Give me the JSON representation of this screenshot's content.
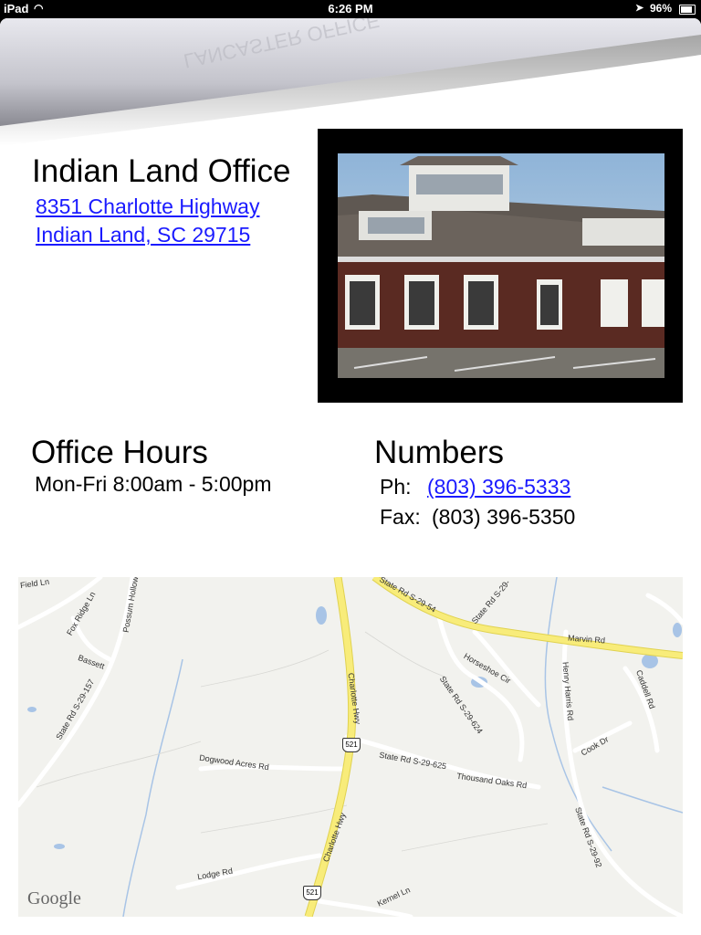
{
  "status_bar": {
    "device": "iPad",
    "time": "6:26 PM",
    "battery": "96%"
  },
  "page_curl": {
    "faded_text": "LANCASTER OFFICE"
  },
  "office": {
    "title": "Indian Land Office",
    "address_line1": "8351 Charlotte Highway",
    "address_line2": "Indian Land, SC 29715"
  },
  "hours": {
    "heading": "Office Hours",
    "text": "Mon-Fri 8:00am - 5:00pm"
  },
  "numbers": {
    "heading": "Numbers",
    "phone_label": "Ph:",
    "phone": "(803) 396-5333",
    "fax_label": "Fax:",
    "fax": "(803) 396-5350"
  },
  "map": {
    "attribution": "Google",
    "labels": {
      "state_rd_54": "State Rd S-29-54",
      "state_rd_29": "State Rd S-29-",
      "marvin_rd": "Marvin Rd",
      "charlotte_hwy_top": "Charlotte Hwy",
      "charlotte_hwy_bottom": "Charlotte Hwy",
      "horseshoe_cir": "Horseshoe Cir",
      "state_rd_624": "State Rd S-29-624",
      "state_rd_625": "State Rd S-29-625",
      "thousand_oaks": "Thousand Oaks Rd",
      "henry_harris": "Henry Harris Rd",
      "caddell": "Caddell Rd",
      "cook_dr": "Cook Dr",
      "state_rd_92": "State Rd S-29-92",
      "dogwood_acres": "Dogwood Acres Rd",
      "lodge_rd": "Lodge Rd",
      "state_rd_157": "State Rd S-29-157",
      "fox_ridge": "Fox Ridge Ln",
      "bassett": "Bassett",
      "possum_hollow": "Possum Hollow",
      "field_ln": "Field Ln",
      "kernel_ln": "Kernel Ln",
      "route_521_a": "521",
      "route_521_b": "521"
    }
  }
}
